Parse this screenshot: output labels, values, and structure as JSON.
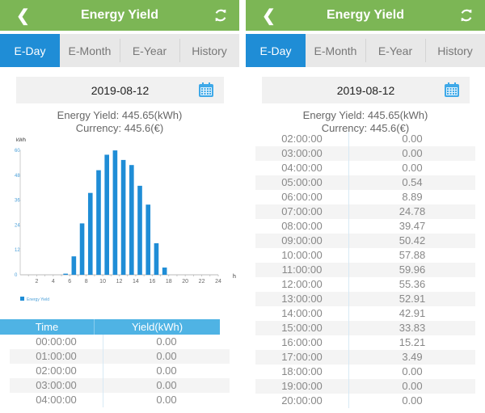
{
  "header": {
    "title": "Energy Yield",
    "back_icon": "chevron-left-icon",
    "refresh_icon": "refresh-icon"
  },
  "tabs": [
    {
      "label": "E-Day",
      "active": true
    },
    {
      "label": "E-Month",
      "active": false
    },
    {
      "label": "E-Year",
      "active": false
    },
    {
      "label": "History",
      "active": false
    }
  ],
  "date": {
    "value": "2019-08-12",
    "icon": "calendar-icon"
  },
  "summary": {
    "energy_yield": "Energy Yield: 445.65(kWh)",
    "currency": "Currency: 445.6(€)"
  },
  "colors": {
    "header": "#7cb655",
    "active_tab": "#1f8dd6",
    "bar": "#1f8dd6",
    "table_header": "#4fb3e4"
  },
  "table": {
    "headers": [
      "Time",
      "Yield(kWh)"
    ],
    "left_rows": [
      [
        "00:00:00",
        "0.00"
      ],
      [
        "01:00:00",
        "0.00"
      ],
      [
        "02:00:00",
        "0.00"
      ],
      [
        "03:00:00",
        "0.00"
      ],
      [
        "04:00:00",
        "0.00"
      ]
    ],
    "right_rows": [
      [
        "02:00:00",
        "0.00"
      ],
      [
        "03:00:00",
        "0.00"
      ],
      [
        "04:00:00",
        "0.00"
      ],
      [
        "05:00:00",
        "0.54"
      ],
      [
        "06:00:00",
        "8.89"
      ],
      [
        "07:00:00",
        "24.78"
      ],
      [
        "08:00:00",
        "39.47"
      ],
      [
        "09:00:00",
        "50.42"
      ],
      [
        "10:00:00",
        "57.88"
      ],
      [
        "11:00:00",
        "59.96"
      ],
      [
        "12:00:00",
        "55.36"
      ],
      [
        "13:00:00",
        "52.91"
      ],
      [
        "14:00:00",
        "42.91"
      ],
      [
        "15:00:00",
        "33.83"
      ],
      [
        "16:00:00",
        "15.21"
      ],
      [
        "17:00:00",
        "3.49"
      ],
      [
        "18:00:00",
        "0.00"
      ],
      [
        "19:00:00",
        "0.00"
      ],
      [
        "20:00:00",
        "0.00"
      ]
    ]
  },
  "chart_data": {
    "type": "bar",
    "title": "",
    "xlabel": "h",
    "ylabel": "kWh",
    "x": [
      0,
      1,
      2,
      3,
      4,
      5,
      6,
      7,
      8,
      9,
      10,
      11,
      12,
      13,
      14,
      15,
      16,
      17,
      18,
      19,
      20,
      21,
      22,
      23
    ],
    "values": [
      0,
      0,
      0,
      0,
      0,
      0.54,
      8.89,
      24.78,
      39.47,
      50.42,
      57.88,
      59.96,
      55.36,
      52.91,
      42.91,
      33.83,
      15.21,
      3.49,
      0,
      0,
      0,
      0,
      0,
      0
    ],
    "series": [
      {
        "name": "Energy Yield"
      }
    ],
    "xlim": [
      0,
      24
    ],
    "ylim": [
      0,
      60
    ],
    "xticks": [
      "2",
      "4",
      "6",
      "8",
      "10",
      "12",
      "14",
      "16",
      "18",
      "20",
      "22",
      "24"
    ],
    "yticks": [
      "0",
      "12",
      "24",
      "36",
      "48",
      "60"
    ],
    "legend": "bottom-left",
    "grid": false
  }
}
